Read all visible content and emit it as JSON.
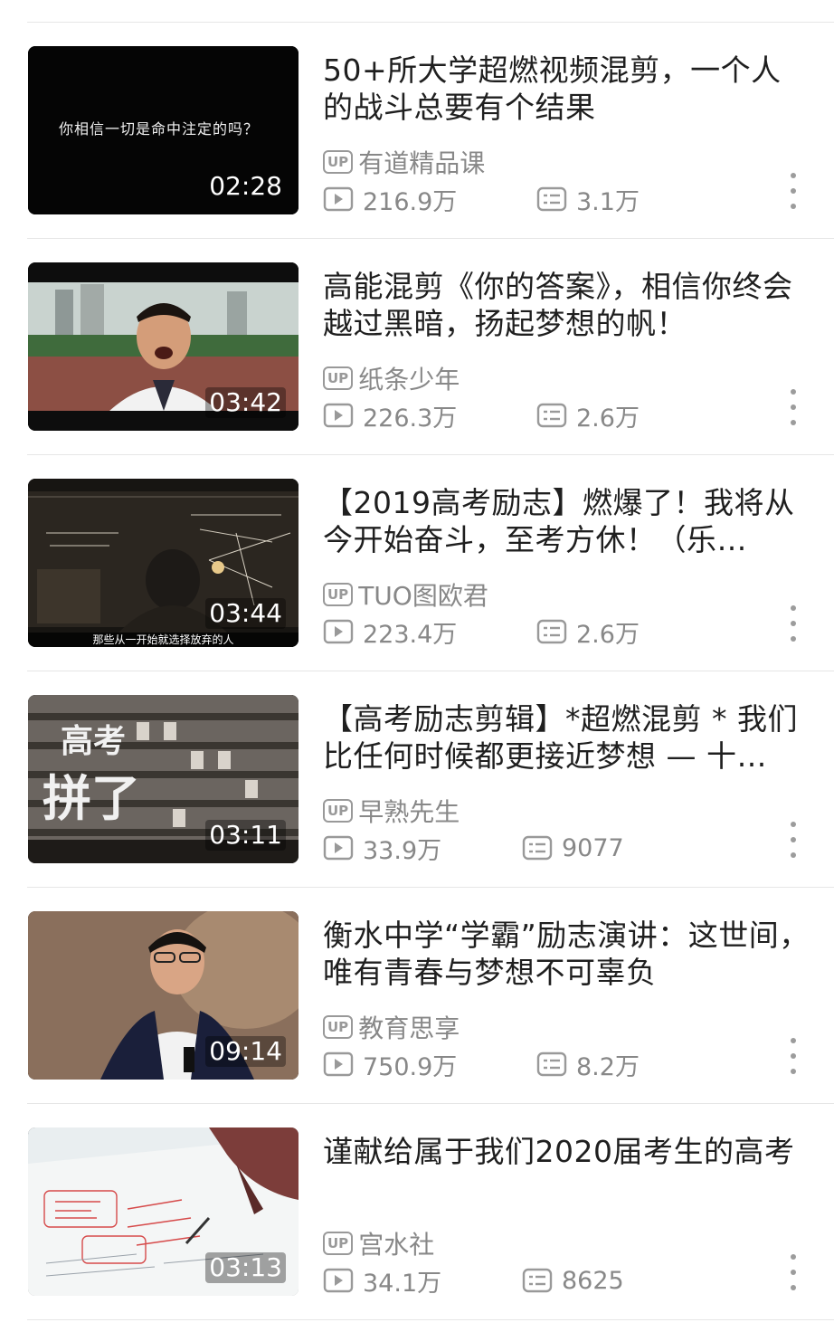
{
  "videos": [
    {
      "title": "50+所大学超燃视频混剪，一个人的战斗总要有个结果",
      "uploader": "有道精品课",
      "up_badge": "UP",
      "views": "216.9万",
      "danmaku": "3.1万",
      "duration": "02:28",
      "thumb_caption": "你相信一切是命中注定的吗？"
    },
    {
      "title": "高能混剪《你的答案》，相信你终会越过黑暗，扬起梦想的帆！",
      "uploader": "纸条少年",
      "up_badge": "UP",
      "views": "226.3万",
      "danmaku": "2.6万",
      "duration": "03:42"
    },
    {
      "title": "【2019高考励志】燃爆了！我将从今开始奋斗，至考方休！（乐…",
      "uploader": "TUO图欧君",
      "up_badge": "UP",
      "views": "223.4万",
      "danmaku": "2.6万",
      "duration": "03:44",
      "thumb_subtitle": "那些从一开始就选择放弃的人"
    },
    {
      "title": "【高考励志剪辑】*超燃混剪 * 我们比任何时候都更接近梦想 — 十…",
      "uploader": "早熟先生",
      "up_badge": "UP",
      "views": "33.9万",
      "danmaku": "9077",
      "duration": "03:11",
      "thumb_calligraphy_1": "高考",
      "thumb_calligraphy_2": "拼了"
    },
    {
      "title": "衡水中学“学霸”励志演讲：这世间，唯有青春与梦想不可辜负",
      "uploader": "教育思享",
      "up_badge": "UP",
      "views": "750.9万",
      "danmaku": "8.2万",
      "duration": "09:14"
    },
    {
      "title": "谨献给属于我们2020届考生的高考",
      "uploader": "宫水社",
      "up_badge": "UP",
      "views": "34.1万",
      "danmaku": "8625",
      "duration": "03:13"
    }
  ],
  "icons": {
    "views": "play-count-icon",
    "danmaku": "danmaku-icon",
    "more": "more-vertical-icon"
  },
  "colors": {
    "title_text": "#1f1f1f",
    "meta_text": "#888888",
    "divider": "#e6e6e6"
  }
}
